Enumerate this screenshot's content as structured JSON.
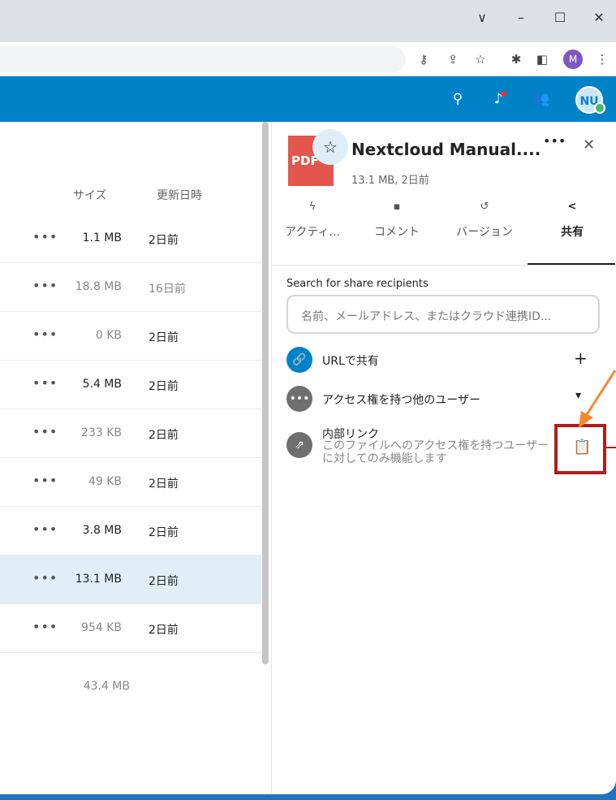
{
  "browser": {
    "window_controls": [
      "∨",
      "–",
      "☐",
      "✕"
    ],
    "toolbar_icons": [
      "key-icon",
      "share-icon",
      "star-icon",
      "extensions-icon",
      "sidepanel-icon",
      "menu-icon"
    ],
    "profile_initial": "M",
    "profile_color": "#7e57c2"
  },
  "header": {
    "color": "#0082c9",
    "icons": [
      "search-icon",
      "notification-bell-icon",
      "contacts-icon"
    ],
    "avatar_initials": "NU",
    "status_color": "#46ba61"
  },
  "filelist": {
    "columns": {
      "size": "サイズ",
      "modified": "更新日時"
    },
    "rows": [
      {
        "size": "1.1 MB",
        "date": "2日前"
      },
      {
        "size": "18.8 MB",
        "date": "16日前"
      },
      {
        "size": "0 KB",
        "date": "2日前"
      },
      {
        "size": "5.4 MB",
        "date": "2日前"
      },
      {
        "size": "233 KB",
        "date": "2日前"
      },
      {
        "size": "49 KB",
        "date": "2日前"
      },
      {
        "size": "3.8 MB",
        "date": "2日前"
      },
      {
        "size": "13.1 MB",
        "date": "2日前"
      },
      {
        "size": "954 KB",
        "date": "2日前"
      }
    ],
    "total_size": "43.4 MB",
    "selected_row": 7,
    "row_action": "•••"
  },
  "sidebar": {
    "thumb_label": "PDF",
    "file_title": "Nextcloud Manual....",
    "file_meta": "13.1 MB, 2日前",
    "more_label": "•••",
    "close_label": "✕",
    "tabs": [
      {
        "label": "アクティ...",
        "icon": "ϟ"
      },
      {
        "label": "コメント",
        "icon": "▪"
      },
      {
        "label": "バージョン",
        "icon": "↺"
      },
      {
        "label": "共有",
        "icon": "<"
      }
    ],
    "active_tab": 3,
    "share": {
      "search_label": "Search for share recipients",
      "search_placeholder": "名前、メールアドレス、またはクラウド連携ID...",
      "url_share_label": "URLで共有",
      "url_share_action": "+",
      "others_label": "アクセス権を持つ他のユーザー",
      "others_action": "▾",
      "internal_link_title": "内部リンク",
      "internal_link_desc": "このファイルへのアクセス権を持つユーザーに対してのみ機能します",
      "link_icon_color": "#0082c9",
      "gray_icon_color": "#6f6f6f"
    }
  },
  "annotation": {
    "highlight_color": "#b01c1c",
    "arrow_color": "#f28a2e"
  }
}
